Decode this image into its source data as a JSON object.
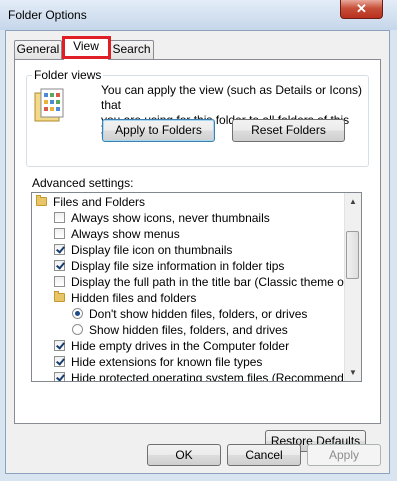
{
  "window": {
    "title": "Folder Options",
    "close_label": "✕"
  },
  "tabs": [
    {
      "label": "General",
      "active": false
    },
    {
      "label": "View",
      "active": true
    },
    {
      "label": "Search",
      "active": false
    }
  ],
  "folder_views": {
    "title": "Folder views",
    "description_line1": "You can apply the view (such as Details or Icons) that",
    "description_line2": "you are using for this folder to all folders of this type.",
    "apply_label": "Apply to Folders",
    "reset_label": "Reset Folders"
  },
  "advanced": {
    "label": "Advanced settings:",
    "items": [
      {
        "type": "folder",
        "label": "Files and Folders"
      },
      {
        "type": "checkbox",
        "label": "Always show icons, never thumbnails",
        "checked": false
      },
      {
        "type": "checkbox",
        "label": "Always show menus",
        "checked": false
      },
      {
        "type": "checkbox",
        "label": "Display file icon on thumbnails",
        "checked": true
      },
      {
        "type": "checkbox",
        "label": "Display file size information in folder tips",
        "checked": true
      },
      {
        "type": "checkbox",
        "label": "Display the full path in the title bar (Classic theme only)",
        "checked": false
      },
      {
        "type": "folder",
        "label": "Hidden files and folders"
      },
      {
        "type": "radio",
        "label": "Don't show hidden files, folders, or drives",
        "checked": true
      },
      {
        "type": "radio",
        "label": "Show hidden files, folders, and drives",
        "checked": false
      },
      {
        "type": "checkbox",
        "label": "Hide empty drives in the Computer folder",
        "checked": true
      },
      {
        "type": "checkbox",
        "label": "Hide extensions for known file types",
        "checked": true
      },
      {
        "type": "checkbox",
        "label": "Hide protected operating system files (Recommended)",
        "checked": true
      }
    ]
  },
  "restore_label": "Restore Defaults",
  "footer": {
    "ok": "OK",
    "cancel": "Cancel",
    "apply": "Apply"
  },
  "colors": {
    "highlight_border": "#e01e25",
    "close_button": "#c7503a"
  }
}
